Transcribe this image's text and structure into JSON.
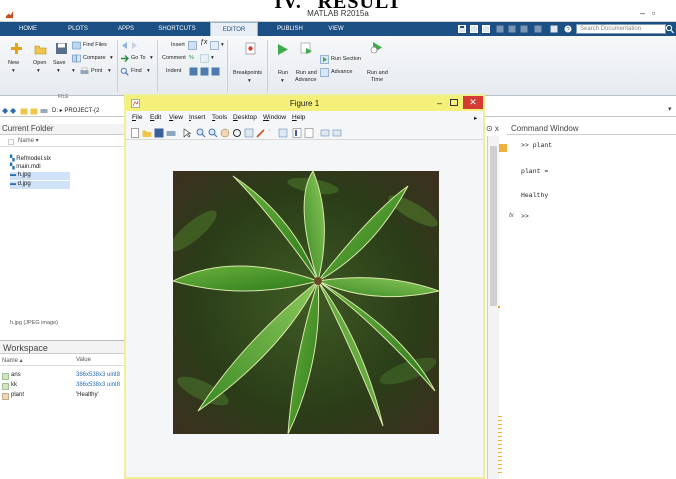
{
  "doc_heading": {
    "numeral": "IV.",
    "word": "RESULT"
  },
  "window": {
    "title": "MATLAB R2015a",
    "minimize": "–",
    "maximize": "▫"
  },
  "tabs": [
    {
      "label": "HOME"
    },
    {
      "label": "PLOTS"
    },
    {
      "label": "APPS"
    },
    {
      "label": "SHORTCUTS"
    },
    {
      "label": "EDITOR"
    },
    {
      "label": "PUBLISH"
    },
    {
      "label": "VIEW"
    }
  ],
  "search": {
    "placeholder": "Search Documentation"
  },
  "toolstrip": {
    "new": "New",
    "open": "Open",
    "save": "Save",
    "find_files": "Find Files",
    "compare": "Compare",
    "print": "Print",
    "go_to": "Go To",
    "find": "Find",
    "insert": "Insert",
    "comment": "Comment",
    "indent": "Indent",
    "breakpoints": "Breakpoints",
    "run": "Run",
    "run_and_advance_1": "Run and",
    "run_and_advance_2": "Advance",
    "run_section": "Run Section",
    "advance": "Advance",
    "run_and_time_1": "Run and",
    "run_and_time_2": "Time",
    "file_group": "FILE"
  },
  "address": {
    "path": "D: ▸ PROJECT-(2"
  },
  "current_folder": {
    "title": "Current Folder",
    "name_col": "Name ▾",
    "files": [
      {
        "name": "Refmodel.slx"
      },
      {
        "name": "main.mdl"
      },
      {
        "name": "h.jpg"
      },
      {
        "name": "d.jpg"
      }
    ],
    "details": "h.jpg (JPEG image)"
  },
  "workspace": {
    "title": "Workspace",
    "col_name": "Name ▴",
    "col_value": "Value",
    "rows": [
      {
        "name": "ans",
        "value": "386x538x3 uint8"
      },
      {
        "name": "kk",
        "value": "386x538x3 uint8"
      },
      {
        "name": "plant",
        "value": "'Healthy'"
      }
    ]
  },
  "figure": {
    "title": "Figure 1",
    "menu": [
      {
        "letter": "F",
        "rest": "ile"
      },
      {
        "letter": "E",
        "rest": "dit"
      },
      {
        "letter": "V",
        "rest": "iew"
      },
      {
        "letter": "I",
        "rest": "nsert"
      },
      {
        "letter": "T",
        "rest": "ools"
      },
      {
        "letter": "D",
        "rest": "esktop"
      },
      {
        "letter": "W",
        "rest": "indow"
      },
      {
        "letter": "H",
        "rest": "elp"
      }
    ]
  },
  "command_window": {
    "title": "Command Window",
    "lines": [
      ">> plant",
      "plant =",
      "Healthy",
      ">>"
    ],
    "fx": "fx"
  },
  "colors": {
    "tabbar": "#1c4f83",
    "figure_title": "#f5f07a",
    "close_red": "#d43b33"
  }
}
